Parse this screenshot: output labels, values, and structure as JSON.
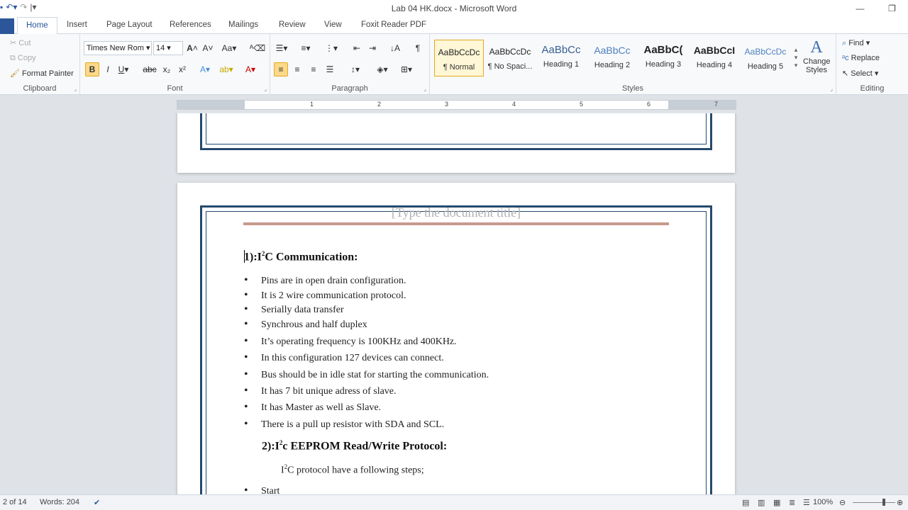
{
  "window": {
    "title": "Lab 04 HK.docx  -  Microsoft Word"
  },
  "tabs": [
    "Home",
    "Insert",
    "Page Layout",
    "References",
    "Mailings",
    "Review",
    "View",
    "Foxit Reader PDF"
  ],
  "clipboard": {
    "cut": "Cut",
    "copy": "Copy",
    "format_painter": "Format Painter",
    "label": "Clipboard"
  },
  "font": {
    "name": "Times New Rom",
    "size": "14",
    "label": "Font"
  },
  "paragraph": {
    "label": "Paragraph"
  },
  "styles": {
    "label": "Styles",
    "items": [
      {
        "preview": "AaBbCcDc",
        "name": "¶ Normal"
      },
      {
        "preview": "AaBbCcDc",
        "name": "¶ No Spaci..."
      },
      {
        "preview": "AaBbCc",
        "name": "Heading 1"
      },
      {
        "preview": "AaBbCc",
        "name": "Heading 2"
      },
      {
        "preview": "AaBbC(",
        "name": "Heading 3"
      },
      {
        "preview": "AaBbCcI",
        "name": "Heading 4"
      },
      {
        "preview": "AaBbCcDc",
        "name": "Heading 5"
      }
    ],
    "change_styles": "Change Styles"
  },
  "editing": {
    "find": "Find",
    "replace": "Replace",
    "select": "Select",
    "label": "Editing"
  },
  "ruler": [
    "1",
    "2",
    "3",
    "4",
    "5",
    "6",
    "7"
  ],
  "doc": {
    "header_placeholder": "[Type the document title]",
    "h1_prefix": "1):I",
    "h1_sup": "2",
    "h1_rest": "C Communication:",
    "bullets": [
      "Pins are in open drain configuration.",
      "It is 2 wire communication protocol.",
      "Serially  data transfer",
      "Synchrous and half duplex",
      "It’s operating frequency is 100KHz and 400KHz.",
      "In this configuration 127 devices can connect.",
      "Bus should be in idle stat for starting the communication.",
      "It has 7 bit unique adress of slave.",
      "It has Master as well as Slave.",
      "There is a pull up resistor with SDA and SCL."
    ],
    "h2_prefix": "2):I",
    "h2_sup": "2",
    "h2_rest": "c EEPROM Read/Write Protocol:",
    "para_prefix": "I",
    "para_sup": "2",
    "para_rest": "C protocol have a following steps;",
    "bullets2": [
      "Start"
    ]
  },
  "status": {
    "page": "2 of 14",
    "words": "Words: 204",
    "zoom": "100%"
  },
  "colors": {
    "accent": "#2b579a",
    "page_border": "#244a6d"
  }
}
